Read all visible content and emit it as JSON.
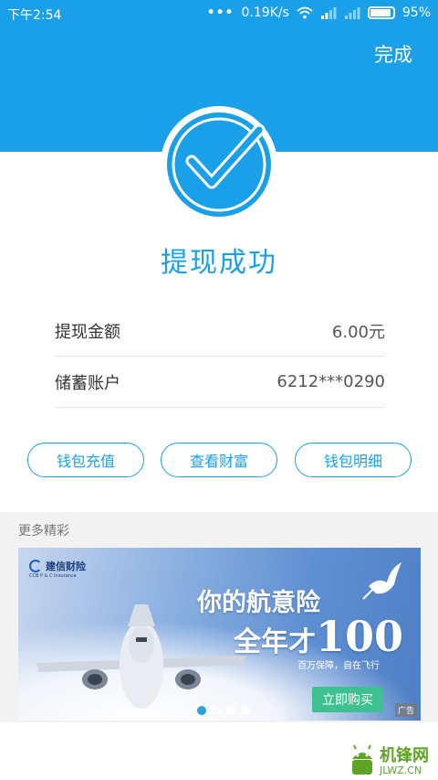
{
  "status_bar": {
    "time": "下午2:54",
    "dots": "•••",
    "speed": "0.19K/s",
    "battery": "95%"
  },
  "header": {
    "done_label": "完成"
  },
  "success": {
    "title": "提现成功"
  },
  "details": [
    {
      "label": "提现金额",
      "value": "6.00元"
    },
    {
      "label": "储蓄账户",
      "value": "6212***0290"
    }
  ],
  "actions": {
    "recharge": "钱包充值",
    "wealth": "查看财富",
    "detail": "钱包明细"
  },
  "more": {
    "title": "更多精彩"
  },
  "banner": {
    "brand": "建信财险",
    "brand_sub": "CCB P & C Insurance",
    "headline_1": "你的航意险",
    "headline_2": "全年才",
    "headline_price": "100",
    "subtitle": "百万保障，自在飞行",
    "buy_label": "立即购买",
    "ad_label": "广告",
    "slide_count": 4,
    "active_slide": 1
  },
  "watermark": {
    "name": "机锋网",
    "url": "JLWZ.CN"
  },
  "colors": {
    "accent": "#1aa0e8",
    "buy_button": "#3fc08f",
    "watermark": "#5da424"
  }
}
